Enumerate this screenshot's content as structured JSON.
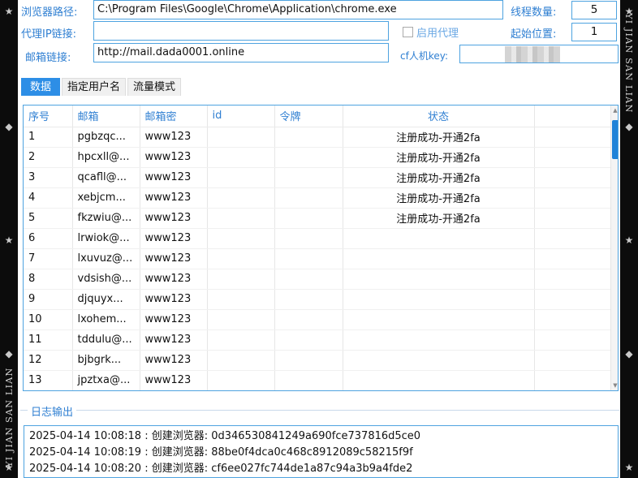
{
  "watermark": {
    "text": "YI JIAN SAN LIAN"
  },
  "form": {
    "browser_path_label": "浏览器路径:",
    "browser_path_value": "C:\\Program Files\\Google\\Chrome\\Application\\chrome.exe",
    "proxy_link_label": "代理IP链接:",
    "proxy_link_value": "",
    "email_link_label": "邮箱链接:",
    "email_link_value": "http://mail.dada0001.online",
    "enable_proxy_label": "启用代理",
    "thread_count_label": "线程数量:",
    "thread_count_value": "5",
    "start_pos_label": "起始位置:",
    "start_pos_value": "1",
    "cf_key_label": "cf人机key:",
    "cf_key_value": ""
  },
  "tabs": [
    {
      "label": "数据",
      "active": true
    },
    {
      "label": "指定用户名",
      "active": false
    },
    {
      "label": "流量模式",
      "active": false
    }
  ],
  "table": {
    "headers": [
      "序号",
      "邮箱",
      "邮箱密",
      "id",
      "令牌",
      "状态",
      ""
    ],
    "rows": [
      [
        "1",
        "pgbzqc...",
        "www123",
        "",
        "",
        "注册成功-开通2fa",
        ""
      ],
      [
        "2",
        "hpcxll@...",
        "www123",
        "",
        "",
        "注册成功-开通2fa",
        ""
      ],
      [
        "3",
        "qcafll@...",
        "www123",
        "",
        "",
        "注册成功-开通2fa",
        ""
      ],
      [
        "4",
        "xebjcm...",
        "www123",
        "",
        "",
        "注册成功-开通2fa",
        ""
      ],
      [
        "5",
        "fkzwiu@...",
        "www123",
        "",
        "",
        "注册成功-开通2fa",
        ""
      ],
      [
        "6",
        "lrwiok@...",
        "www123",
        "",
        "",
        "",
        ""
      ],
      [
        "7",
        "lxuvuz@...",
        "www123",
        "",
        "",
        "",
        ""
      ],
      [
        "8",
        "vdsish@...",
        "www123",
        "",
        "",
        "",
        ""
      ],
      [
        "9",
        "djquyx...",
        "www123",
        "",
        "",
        "",
        ""
      ],
      [
        "10",
        "lxohem...",
        "www123",
        "",
        "",
        "",
        ""
      ],
      [
        "11",
        "tddulu@...",
        "www123",
        "",
        "",
        "",
        ""
      ],
      [
        "12",
        "bjbgrk...",
        "www123",
        "",
        "",
        "",
        ""
      ],
      [
        "13",
        "jpztxa@...",
        "www123",
        "",
        "",
        "",
        ""
      ]
    ]
  },
  "log": {
    "title": "日志输出",
    "lines": [
      "2025-04-14 10:08:18 : 创建浏览器: 0d346530841249a690fce737816d5ce0",
      "2025-04-14 10:08:19 : 创建浏览器: 88be0f4dca0c468c8912089c58215f9f",
      "2025-04-14 10:08:20 : 创建浏览器: cf6ee027fc744de1a87c94a3b9a4fde2"
    ]
  },
  "colors": {
    "accent": "#2d8ee6",
    "label": "#2f7fd2",
    "border": "#4ea3e0"
  }
}
